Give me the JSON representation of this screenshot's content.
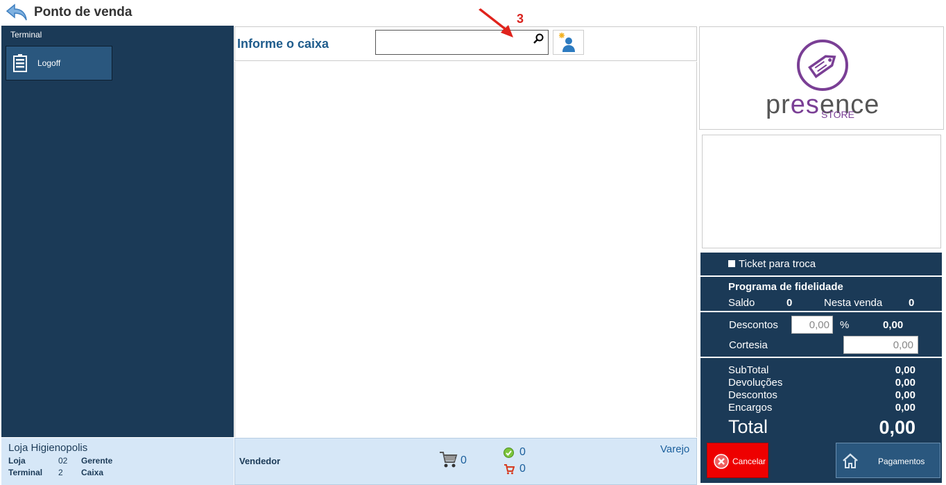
{
  "header": {
    "title": "Ponto de venda"
  },
  "sidebar": {
    "section_label": "Terminal",
    "logoff_label": "Logoff"
  },
  "footer_left": {
    "store_name": "Loja Higienopolis",
    "loja_label": "Loja",
    "loja_value": "02",
    "gerente_label": "Gerente",
    "terminal_label": "Terminal",
    "terminal_value": "2",
    "caixa_label": "Caixa"
  },
  "center": {
    "header_label": "Informe o caixa",
    "search_value": "",
    "annotation_number": "3"
  },
  "footer_center": {
    "vendedor_label": "Vendedor",
    "cart_count": "0",
    "checked_count": "0",
    "cart2_count": "0",
    "channel": "Varejo"
  },
  "logo": {
    "brand": "presence",
    "sub": "STORE",
    "accent": "#7a3f95"
  },
  "right_panel": {
    "ticket_label": "Ticket para troca",
    "fidelity_title": "Programa de fidelidade",
    "saldo_label": "Saldo",
    "saldo_value": "0",
    "nesta_venda_label": "Nesta venda",
    "nesta_venda_value": "0",
    "descontos_label": "Descontos",
    "descontos_input": "0,00",
    "percent_symbol": "%",
    "descontos_total": "0,00",
    "cortesia_label": "Cortesia",
    "cortesia_input": "0,00",
    "subtotal_label": "SubTotal",
    "subtotal_value": "0,00",
    "devolucoes_label": "Devoluções",
    "devolucoes_value": "0,00",
    "descontos2_label": "Descontos",
    "descontos2_value": "0,00",
    "encargos_label": "Encargos",
    "encargos_value": "0,00",
    "total_label": "Total",
    "total_value": "0,00",
    "cancel_label": "Cancelar",
    "pay_label": "Pagamentos"
  },
  "colors": {
    "sidebar": "#1b3a57",
    "footer": "#d6e7f7",
    "cancel": "#ee0000",
    "accent_text": "#1f5c8c"
  }
}
